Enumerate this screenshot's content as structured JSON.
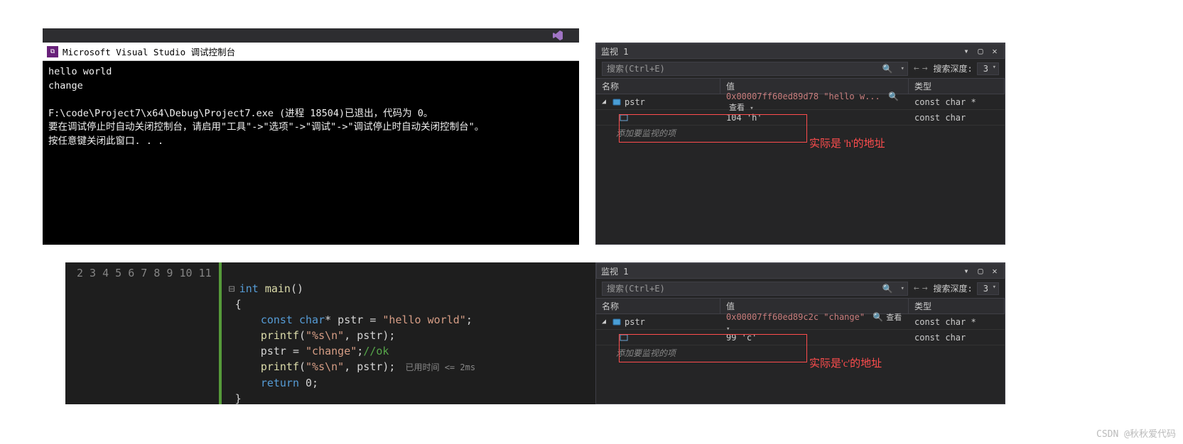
{
  "console": {
    "vs_badge": "",
    "title": "Microsoft Visual Studio 调试控制台",
    "lines": [
      "hello world",
      "change",
      "",
      "F:\\code\\Project7\\x64\\Debug\\Project7.exe (进程 18504)已退出，代码为 0。",
      "要在调试停止时自动关闭控制台，请启用\"工具\"->\"选项\"->\"调试\"->\"调试停止时自动关闭控制台\"。",
      "按任意键关闭此窗口. . ."
    ]
  },
  "watch": {
    "title": "监视 1",
    "search_placeholder": "搜索(Ctrl+E)",
    "depth_label": "搜索深度:",
    "depth_value": "3",
    "col_name": "名称",
    "col_value": "值",
    "col_type": "类型",
    "view_label": "查看",
    "add_item_hint": "添加要监视的项"
  },
  "watch_top": {
    "rows": [
      {
        "name": "pstr",
        "value": "0x00007ff60ed89d78 \"hello w...",
        "type": "const char *",
        "expandable": true,
        "icon": "obj"
      },
      {
        "name": "",
        "value": "104 'h'",
        "type": "const char",
        "expandable": false,
        "icon": "box"
      }
    ],
    "annotation": "实际是 'h'的地址"
  },
  "watch_bot": {
    "rows": [
      {
        "name": "pstr",
        "value": "0x00007ff60ed89c2c \"change\"",
        "type": "const char *",
        "expandable": true,
        "icon": "obj"
      },
      {
        "name": "",
        "value": "99 'c'",
        "type": "const char",
        "expandable": false,
        "icon": "box"
      }
    ],
    "annotation": "实际是'c'的地址"
  },
  "editor": {
    "line_start": 2,
    "timing": "已用时间 <= 2ms"
  },
  "watermark": "CSDN @秋秋爱代码"
}
